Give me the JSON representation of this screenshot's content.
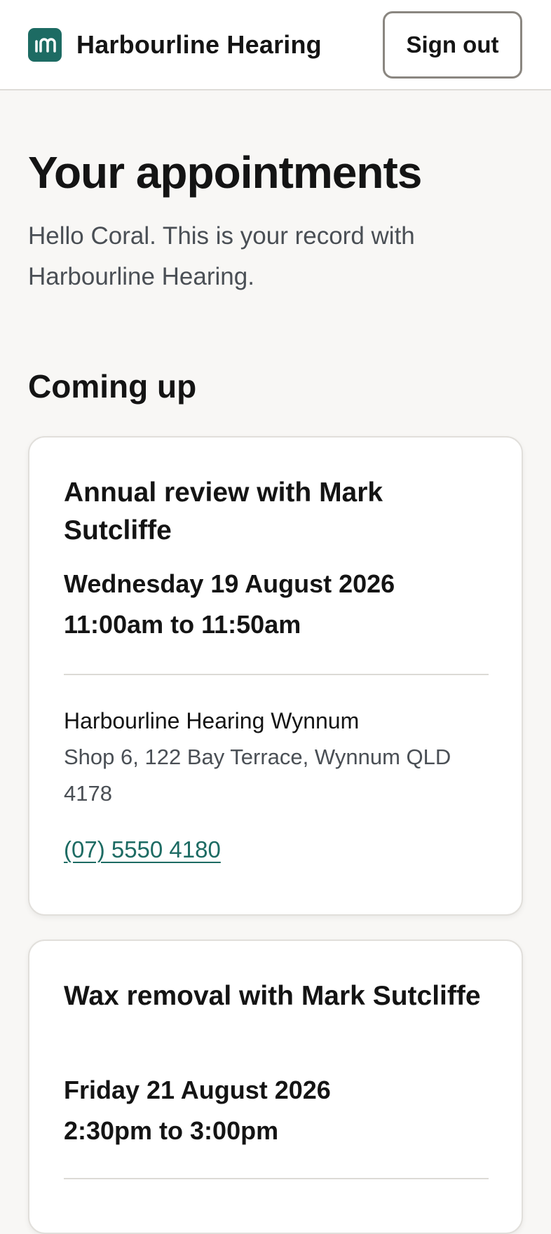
{
  "header": {
    "brand_name": "Harbourline Hearing",
    "logo_icon": "harbourline-logo-icon",
    "sign_out_label": "Sign out",
    "accent_color": "#1d6b63"
  },
  "main": {
    "title": "Your appointments",
    "intro": "Hello Coral. This is your record with Harbourline Hearing.",
    "section_heading": "Coming up"
  },
  "appointments": [
    {
      "title": "Annual review with Mark Sutcliffe",
      "date": "Wednesday 19 August 2026",
      "time": "11:00am to 11:50am",
      "clinic": "Harbourline Hearing Wynnum",
      "address": "Shop 6, 122 Bay Terrace, Wynnum QLD 4178",
      "phone": "(07) 5550 4180"
    },
    {
      "title": "Wax removal with Mark Sutcliffe",
      "date": "Friday 21 August 2026",
      "time": "2:30pm to 3:00pm"
    }
  ]
}
